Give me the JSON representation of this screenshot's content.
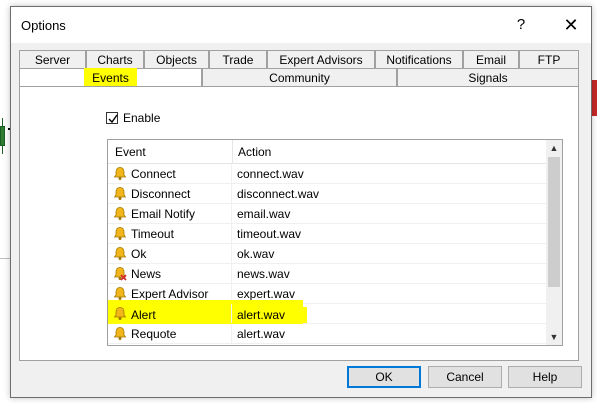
{
  "window": {
    "title": "Options",
    "help_glyph": "?",
    "close_glyph": "✕"
  },
  "tabs_row1": [
    {
      "label": "Server"
    },
    {
      "label": "Charts"
    },
    {
      "label": "Objects"
    },
    {
      "label": "Trade"
    },
    {
      "label": "Expert Advisors"
    },
    {
      "label": "Notifications"
    },
    {
      "label": "Email"
    },
    {
      "label": "FTP"
    }
  ],
  "tabs_row2": [
    {
      "label": "Events",
      "active": true,
      "highlighted": true
    },
    {
      "label": "Community"
    },
    {
      "label": "Signals"
    }
  ],
  "enable": {
    "label": "Enable",
    "checked": true
  },
  "table": {
    "columns": [
      "Event",
      "Action"
    ],
    "rows": [
      {
        "event": "Connect",
        "action": "connect.wav",
        "icon": "bell-icon"
      },
      {
        "event": "Disconnect",
        "action": "disconnect.wav",
        "icon": "bell-icon"
      },
      {
        "event": "Email Notify",
        "action": "email.wav",
        "icon": "bell-icon"
      },
      {
        "event": "Timeout",
        "action": "timeout.wav",
        "icon": "bell-icon"
      },
      {
        "event": "Ok",
        "action": "ok.wav",
        "icon": "bell-icon"
      },
      {
        "event": "News",
        "action": "news.wav",
        "icon": "bell-disabled-icon"
      },
      {
        "event": "Expert Advisor",
        "action": "expert.wav",
        "icon": "bell-icon"
      },
      {
        "event": "Alert",
        "action": "alert.wav",
        "icon": "bell-icon",
        "highlighted": true
      },
      {
        "event": "Requote",
        "action": "alert.wav",
        "icon": "bell-icon"
      }
    ]
  },
  "buttons": {
    "ok": "OK",
    "cancel": "Cancel",
    "help": "Help"
  },
  "colors": {
    "highlight": "#ffff00",
    "accent": "#0078d7",
    "bell": "#f2b61a"
  }
}
